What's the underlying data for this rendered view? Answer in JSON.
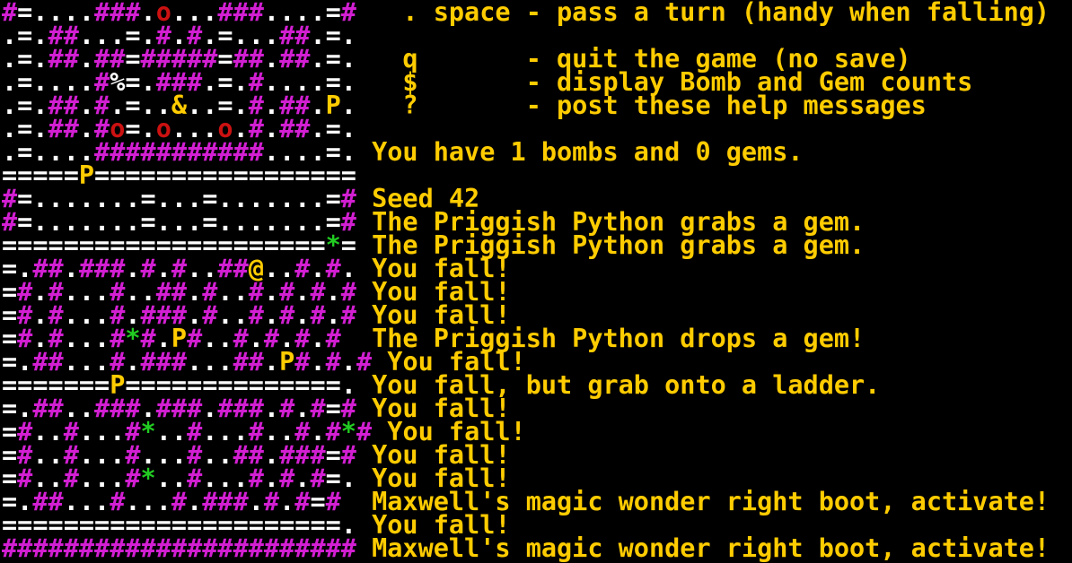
{
  "colors": {
    "background": "#000000",
    "wall": "#d21fd2",
    "floor": "#ffffff",
    "text": "#ffcc00",
    "gem": "#22cc22",
    "bomb": "#cc1111",
    "player": "#ffcc00",
    "python": "#ffcc00"
  },
  "legend": {
    "#": "wall",
    ".": "floor",
    "=": "ladder",
    "%": "floor",
    "&": "text",
    "*": "gem",
    "o": "bomb",
    "P": "python",
    "@": "player"
  },
  "map_rows": [
    "#=....###.o...###....=#",
    ".=.##...=.#.#.=...##.=.",
    ".=.##.##=#####=##.##.=.",
    ".=....#%=.###.=.#....=.",
    ".=.##.#.=..&..=.#.##.P.",
    ".=.##.#o=.o...o.#.##.=.",
    ".=....###########....=.",
    "=====P=================",
    "#=.......=...=.......=#",
    "#=.......=...=.......=#",
    "=====================*=",
    "=.##.###.#.#..##@..#.#.",
    "=#.#...#..##.#..#.#.#.#",
    "=#.#...#.###.#..#.#.#.#",
    "=#.#...#*#.P#..#.#.#.#",
    "=.##...#.###...##.P#.#.#",
    "=======P==============.",
    "=.##..###.###.###.#.#=#",
    "=#..#...#*..#...#..#.#*#",
    "=#..#...#...#..##.###=#",
    "=#..#...#*..#...#.#.#=.",
    "=.##...#...#.###.#.#=#",
    "======================.",
    "#######################"
  ],
  "log_lines": [
    "   . space - pass a turn (handy when falling)",
    "",
    "   q       - quit the game (no save)",
    "   $       - display Bomb and Gem counts",
    "   ?       - post these help messages",
    "",
    " You have 1 bombs and 0 gems.",
    "",
    " Seed 42",
    " The Priggish Python grabs a gem.",
    " The Priggish Python grabs a gem.",
    " You fall!",
    " You fall!",
    " You fall!",
    " The Priggish Python drops a gem!",
    " You fall!",
    " You fall, but grab onto a ladder.",
    " You fall!",
    " You fall!",
    " You fall!",
    " You fall!",
    " Maxwell's magic wonder right boot, activate!",
    " You fall!",
    " Maxwell's magic wonder right boot, activate!"
  ]
}
